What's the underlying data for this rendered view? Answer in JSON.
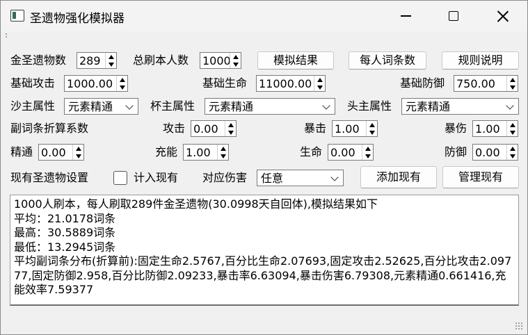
{
  "window": {
    "title": "圣遗物强化模拟器"
  },
  "row1": {
    "artifact_count_label": "金圣遗物数",
    "artifact_count_value": "289",
    "total_runs_label": "总刷本人数",
    "total_runs_value": "1000",
    "simulate_button": "模拟结果",
    "per_person_button": "每人词条数",
    "rules_button": "规则说明"
  },
  "row2": {
    "base_atk_label": "基础攻击",
    "base_atk_value": "1000.00",
    "base_hp_label": "基础生命",
    "base_hp_value": "11000.00",
    "base_def_label": "基础防御",
    "base_def_value": "750.00"
  },
  "row3": {
    "sands_label": "沙主属性",
    "sands_value": "元素精通",
    "goblet_label": "杯主属性",
    "goblet_value": "元素精通",
    "circlet_label": "头主属性",
    "circlet_value": "元素精通"
  },
  "row4": {
    "coef_label": "副词条折算系数",
    "atk_label": "攻击",
    "atk_value": "0.00",
    "crit_rate_label": "暴击",
    "crit_rate_value": "1.00",
    "crit_dmg_label": "暴伤",
    "crit_dmg_value": "1.00"
  },
  "row5": {
    "em_label": "精通",
    "em_value": "0.00",
    "er_label": "充能",
    "er_value": "1.00",
    "hp_label": "生命",
    "hp_value": "0.00",
    "def_label": "防御",
    "def_value": "0.00"
  },
  "row6": {
    "current_setup_label": "现有圣遗物设置",
    "include_current_label": "计入现有",
    "include_current_checked": false,
    "damage_label": "对应伤害",
    "damage_value": "任意",
    "add_button": "添加现有",
    "manage_button": "管理现有"
  },
  "result": {
    "lines": [
      "1000人刷本，每人刷取289件金圣遗物(30.0998天自回体),模拟结果如下",
      "平均：21.0178词条",
      "最高：30.5889词条",
      "最低：13.2945词条",
      "平均副词条分布(折算前):固定生命2.5767,百分比生命2.07693,固定攻击2.52625,百分比攻击2.09777,固定防御2.958,百分比防御2.09233,暴击率6.63094,暴击伤害6.79308,元素精通0.661416,充能效率7.59377"
    ]
  }
}
